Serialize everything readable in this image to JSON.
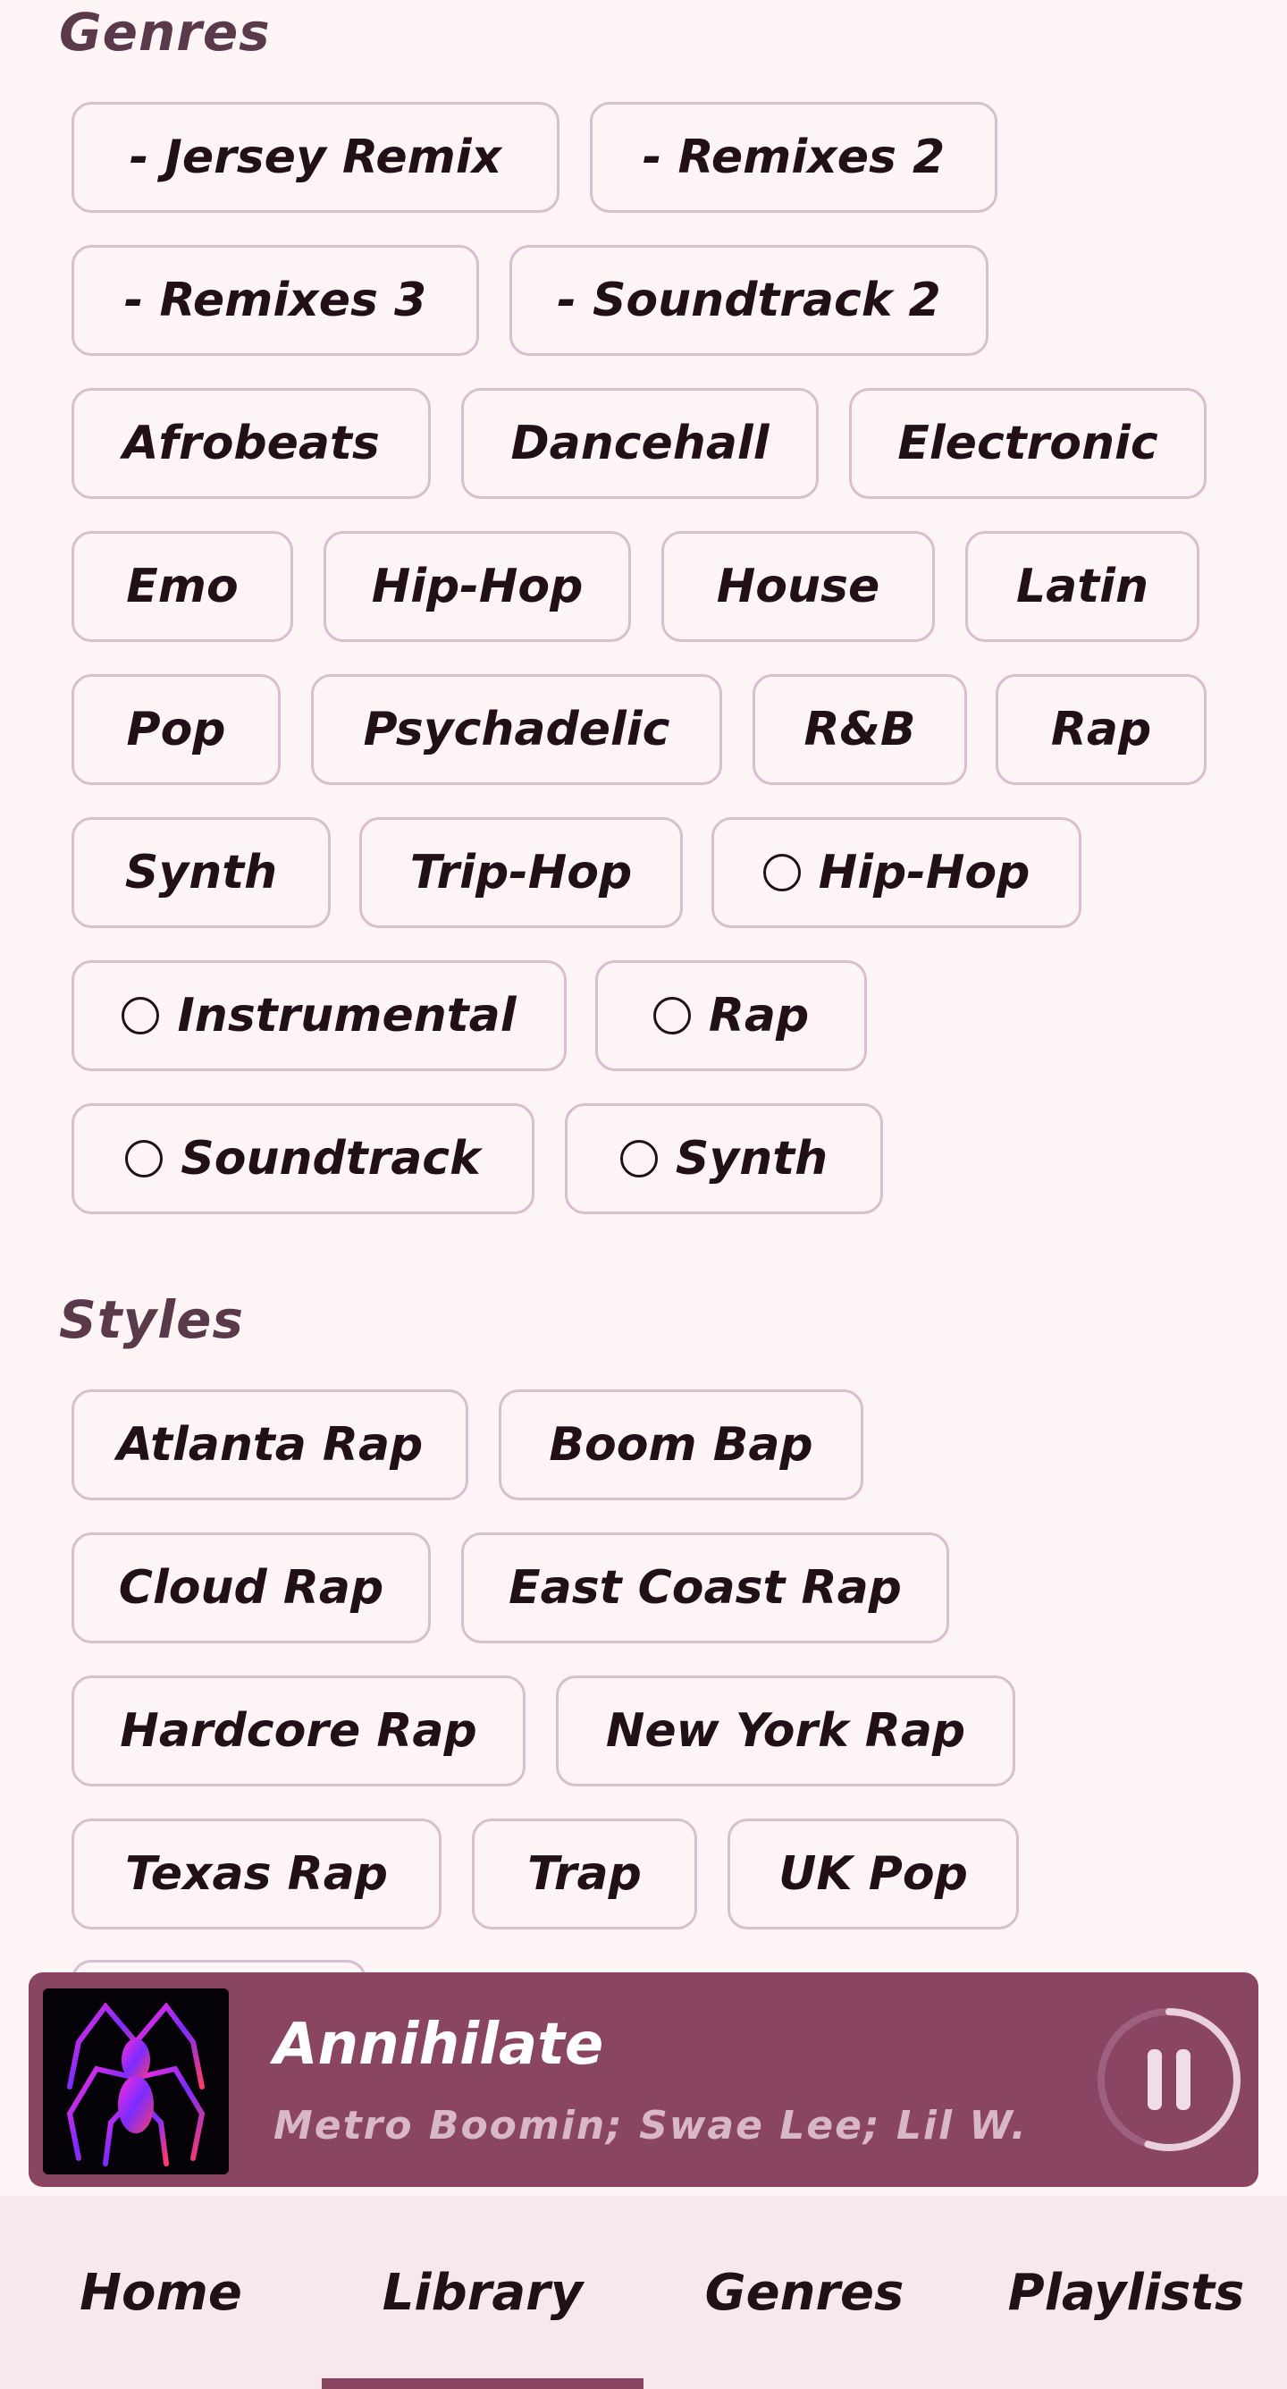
{
  "sections": {
    "genres_title": "Genres",
    "styles_title": "Styles"
  },
  "genres": [
    "- Jersey Remix",
    "- Remixes 2",
    "- Remixes 3",
    "- Soundtrack 2",
    "Afrobeats",
    "Dancehall",
    "Electronic",
    "Emo",
    "Hip-Hop",
    "House",
    "Latin",
    "Pop",
    "Psychadelic",
    "R&B",
    "Rap",
    "Synth",
    "Trip-Hop",
    "Hip-Hop",
    "Instrumental",
    "Rap",
    "Soundtrack",
    "Synth"
  ],
  "styles": [
    "Atlanta Rap",
    "Boom Bap",
    "Cloud Rap",
    "East Coast Rap",
    "Hardcore Rap",
    "New York Rap",
    "Texas Rap",
    "Trap",
    "UK Pop"
  ],
  "player": {
    "title": "Annihilate",
    "artist": "Metro Boomin; Swae Lee; Lil W. . .",
    "progress": 0.55,
    "accent": "#8a4563"
  },
  "nav": {
    "home": "Home",
    "library": "Library",
    "genres": "Genres",
    "playlists": "Playlists",
    "active": "Library"
  },
  "icons": {
    "pause": "pause-icon",
    "radio": "circle-outline-icon",
    "album_art": "spider-emblem"
  },
  "colors": {
    "background": "#fcf4f5",
    "chip_border": "#d9bdd0",
    "player_bg": "#8a4563",
    "nav_bg": "#f6e8ec"
  }
}
